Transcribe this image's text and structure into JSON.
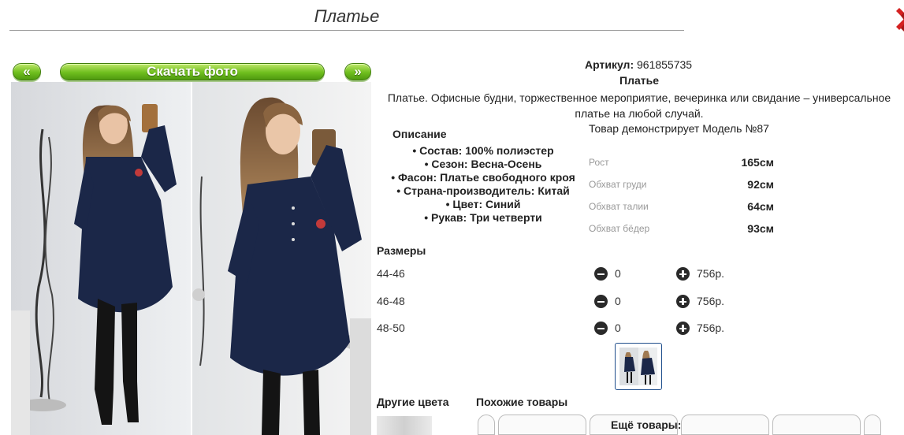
{
  "page": {
    "title": "Платье"
  },
  "gallery": {
    "prev_label": "«",
    "next_label": "»",
    "download_label": "Скачать фото"
  },
  "product": {
    "article_label": "Артикул:",
    "article_value": "961855735",
    "name": "Платье",
    "description": "Платье. Офисные будни, торжественное мероприятие, вечеринка или свидание – универсальное платье на любой случай.",
    "model_note": "Товар демонстрирует Модель №87",
    "description_heading": "Описание",
    "specs": [
      "Состав: 100% полиэстер",
      "Сезон: Весна-Осень",
      "Фасон: Платье свободного кроя",
      "Страна-производитель: Китай",
      "Цвет: Синий",
      "Рукав: Три четверти"
    ],
    "measurements": [
      {
        "label": "Рост",
        "value": "165см"
      },
      {
        "label": "Обхват груди",
        "value": "92см"
      },
      {
        "label": "Обхват талии",
        "value": "64см"
      },
      {
        "label": "Обхват бёдер",
        "value": "93см"
      }
    ]
  },
  "sizes": {
    "heading": "Размеры",
    "rows": [
      {
        "size": "44-46",
        "qty": "0",
        "price": "756р."
      },
      {
        "size": "46-48",
        "qty": "0",
        "price": "756р."
      },
      {
        "size": "48-50",
        "qty": "0",
        "price": "756р."
      }
    ]
  },
  "bottom": {
    "other_colors": "Другие цвета",
    "similar": "Похожие товары",
    "more": "Ещё товары:"
  },
  "colors": {
    "accent_green": "#6fbf1e",
    "dress_navy": "#1b2748",
    "close_red": "#d42020"
  },
  "icons": [
    "close-icon",
    "minus-icon",
    "plus-icon"
  ]
}
